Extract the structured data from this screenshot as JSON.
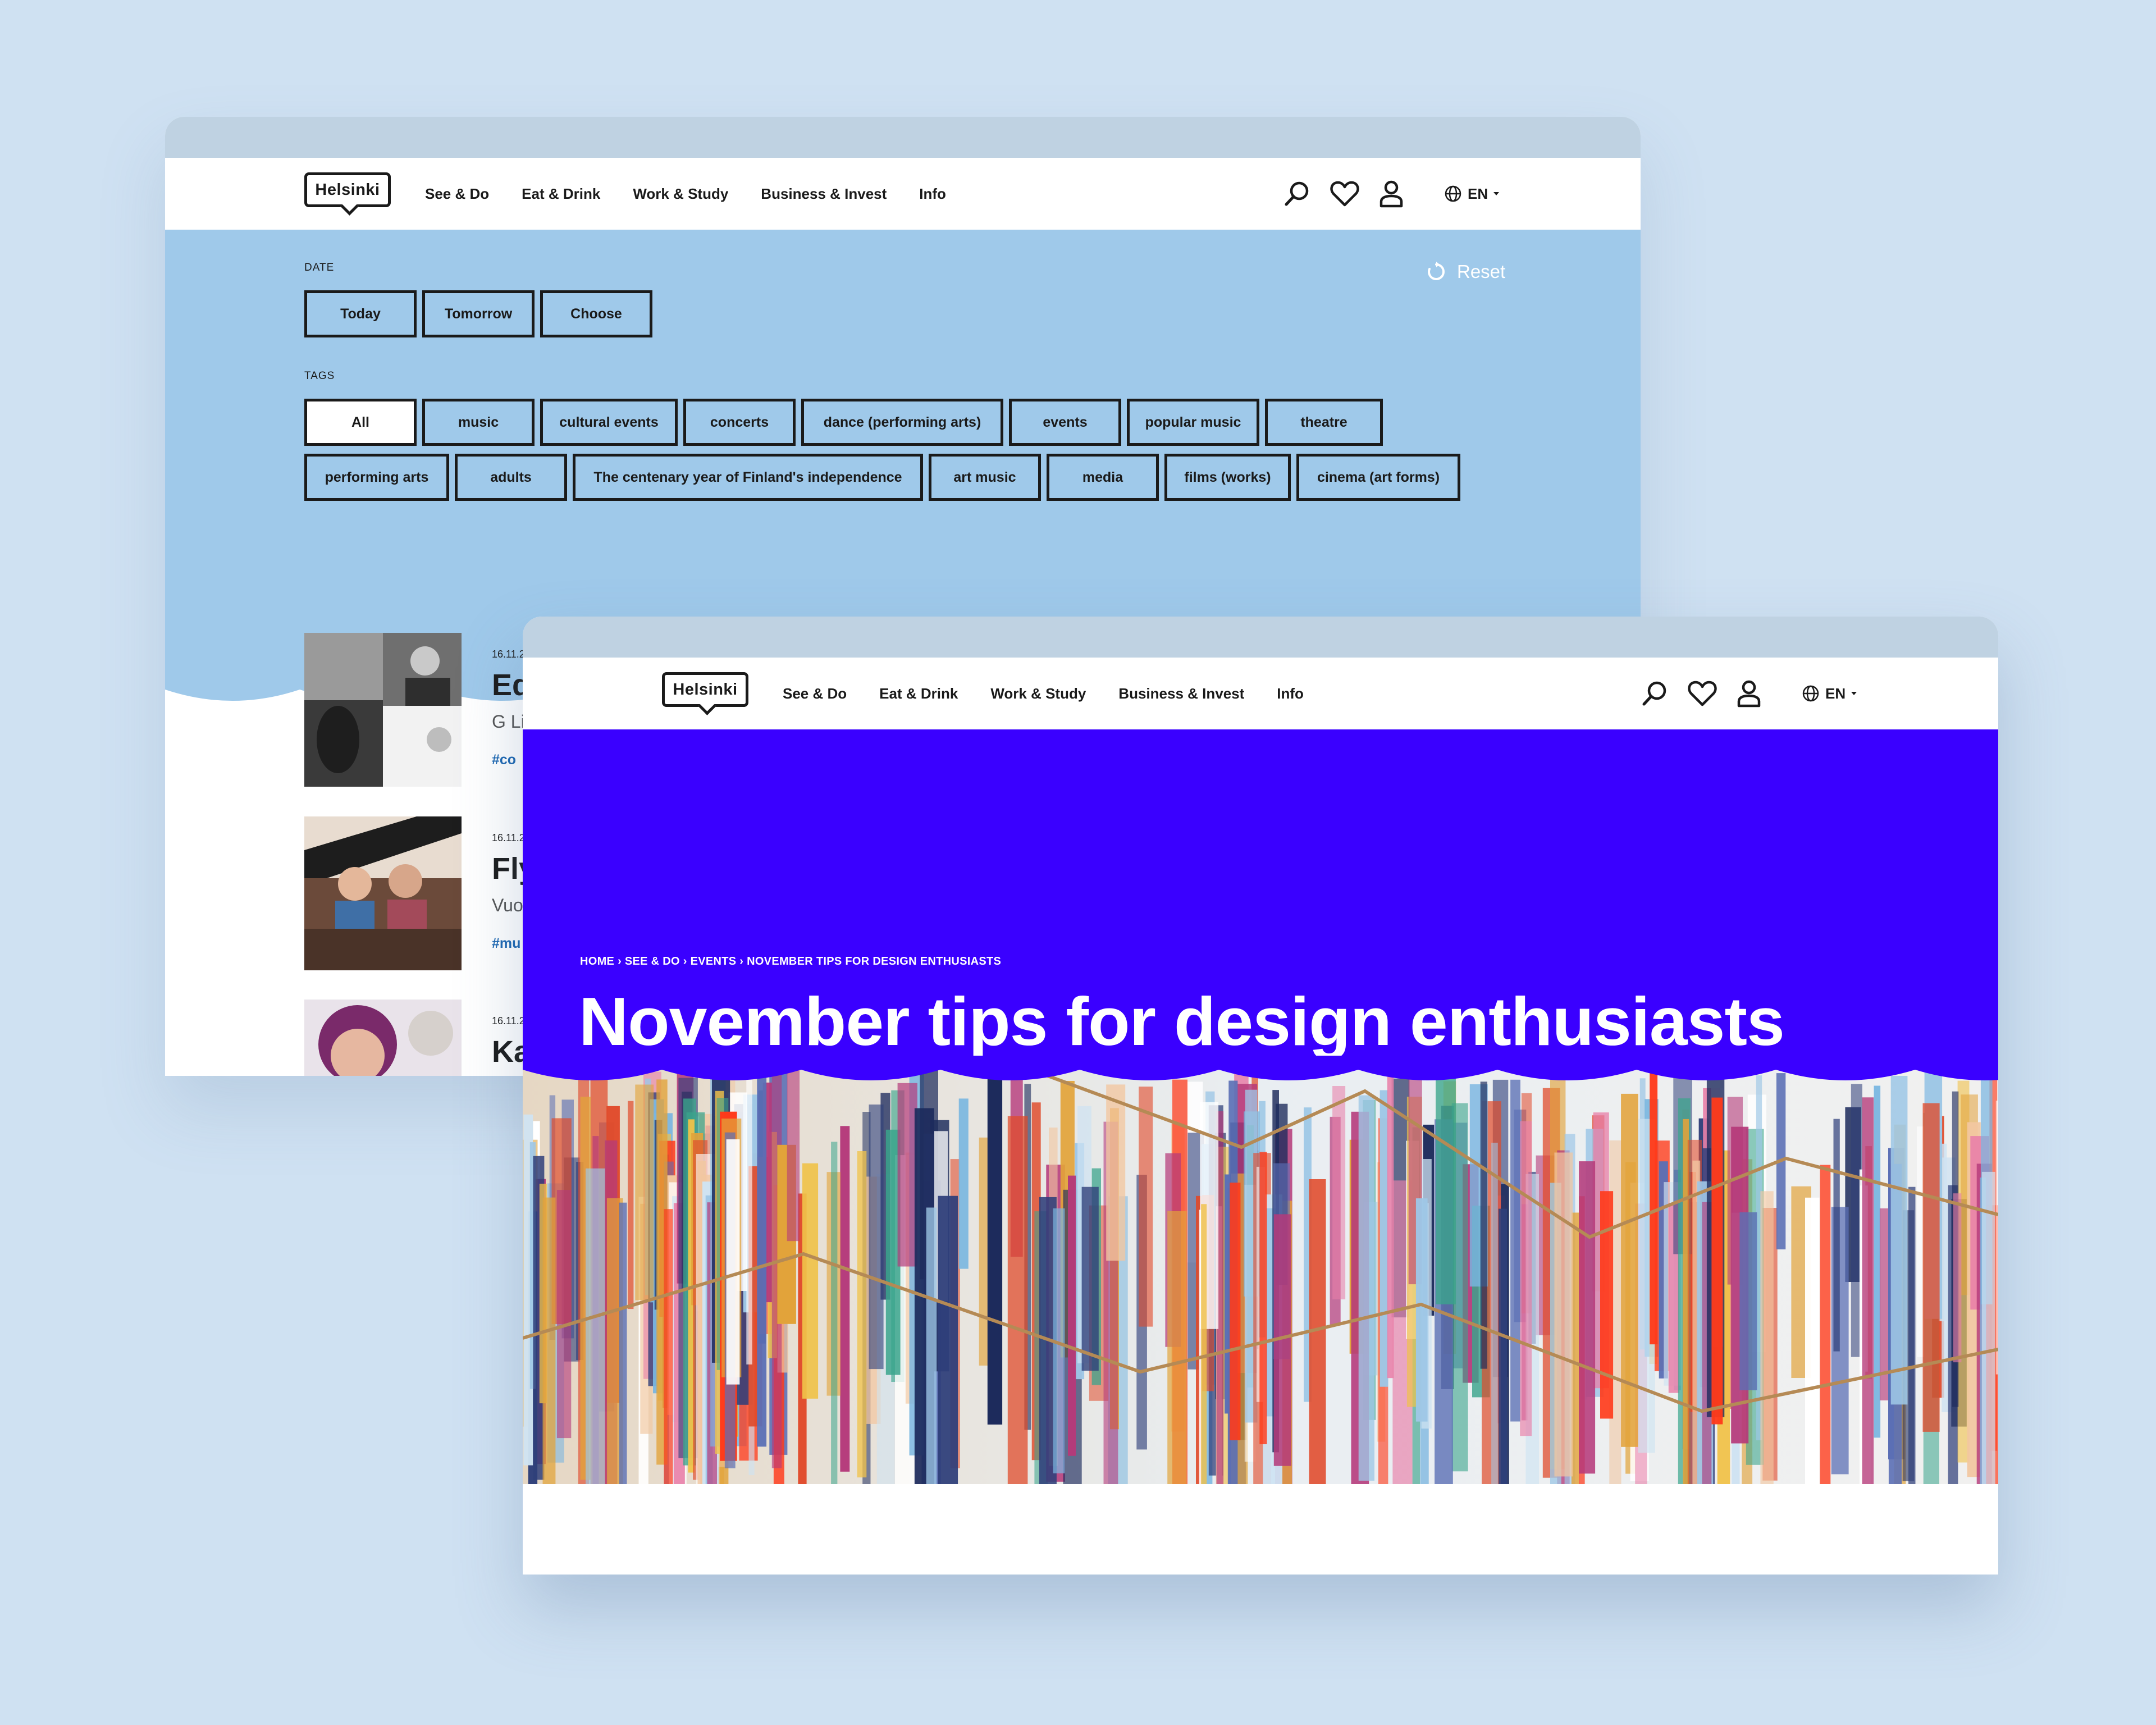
{
  "back_window": {
    "nav": {
      "logo": "Helsinki",
      "menu": [
        "See & Do",
        "Eat & Drink",
        "Work & Study",
        "Business & Invest",
        "Info"
      ],
      "lang": "EN",
      "icons": [
        "search-icon",
        "heart-icon",
        "user-icon",
        "globe-icon"
      ]
    },
    "filters": {
      "date_label": "DATE",
      "reset_label": "Reset",
      "date_buttons": [
        "Today",
        "Tomorrow",
        "Choose"
      ],
      "tags_label": "TAGS",
      "tags_row1": [
        "All",
        "music",
        "cultural events",
        "concerts",
        "dance (performing arts)",
        "events",
        "popular music",
        "theatre"
      ],
      "tags_row2": [
        "performing arts",
        "adults",
        "The centenary year of Finland's independence",
        "art music",
        "media",
        "films (works)",
        "cinema (art forms)"
      ],
      "selected_tag": "All"
    },
    "events": [
      {
        "date": "16.11.2",
        "title": "Ed",
        "subtitle": "G Li",
        "tag": "#co"
      },
      {
        "date": "16.11.2",
        "title": "Fly",
        "subtitle": "Vuo",
        "tag": "#mu"
      },
      {
        "date": "16.11.2",
        "title": "Ka",
        "subtitle": "",
        "tag": ""
      }
    ]
  },
  "front_window": {
    "nav": {
      "logo": "Helsinki",
      "menu": [
        "See & Do",
        "Eat & Drink",
        "Work & Study",
        "Business & Invest",
        "Info"
      ],
      "lang": "EN"
    },
    "breadcrumb": [
      "HOME",
      "SEE & DO",
      "EVENTS",
      "NOVEMBER TIPS FOR DESIGN ENTHUSIASTS"
    ],
    "breadcrumb_sep": "›",
    "title": "November tips for design enthusiasts",
    "colors": {
      "hero": "#3a00ff",
      "filter_bg": "#9fc9ea",
      "tag_link": "#1b66b1"
    }
  }
}
